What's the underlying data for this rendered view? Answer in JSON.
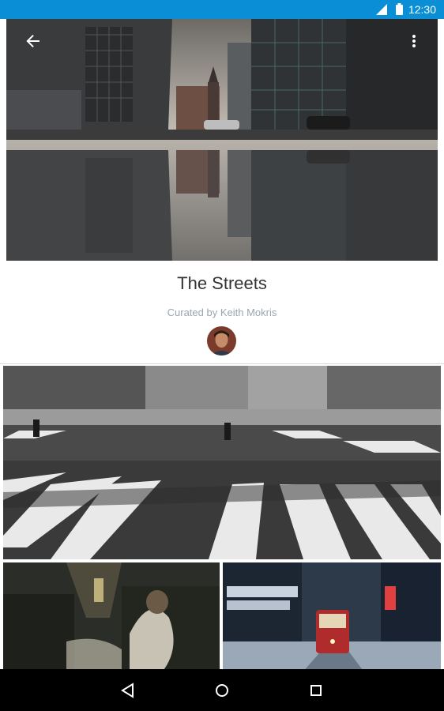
{
  "status_bar": {
    "time": "12:30",
    "signal_icon": "signal-icon",
    "battery_icon": "battery-icon",
    "background": "#0a8fd6"
  },
  "header": {
    "back_icon": "arrow-back-icon",
    "more_icon": "more-vert-icon"
  },
  "collection": {
    "title": "The Streets",
    "curator": "Curated by Keith Mokris"
  },
  "nav_bar": {
    "back_icon": "nav-back-icon",
    "home_icon": "nav-home-icon",
    "recents_icon": "nav-recents-icon"
  }
}
